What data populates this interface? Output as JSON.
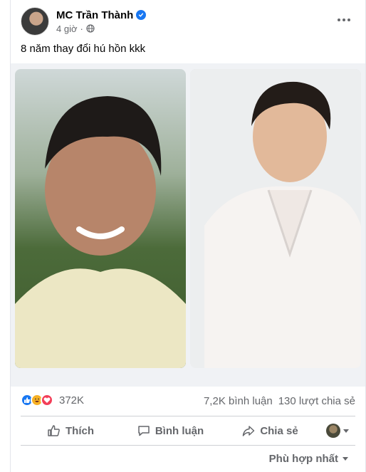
{
  "post": {
    "author": "MC Trần Thành",
    "time": "4 giờ",
    "caption": "8 năm thay đổi hú hồn kkk"
  },
  "icons": {
    "verified": "verified-badge-icon",
    "audience": "globe-icon",
    "more": "more-options-icon"
  },
  "reactions": {
    "types": [
      "like",
      "haha",
      "love"
    ],
    "count": "372K"
  },
  "stats": {
    "comments": "7,2K bình luận",
    "shares": "130 lượt chia sẻ"
  },
  "actions": {
    "like": "Thích",
    "comment": "Bình luận",
    "share": "Chia sẻ"
  },
  "sort": {
    "label": "Phù hợp nhất"
  },
  "colors": {
    "accent": "#1877f2",
    "muted": "#65676b",
    "love": "#f33e58",
    "haha": "#f7b125"
  }
}
